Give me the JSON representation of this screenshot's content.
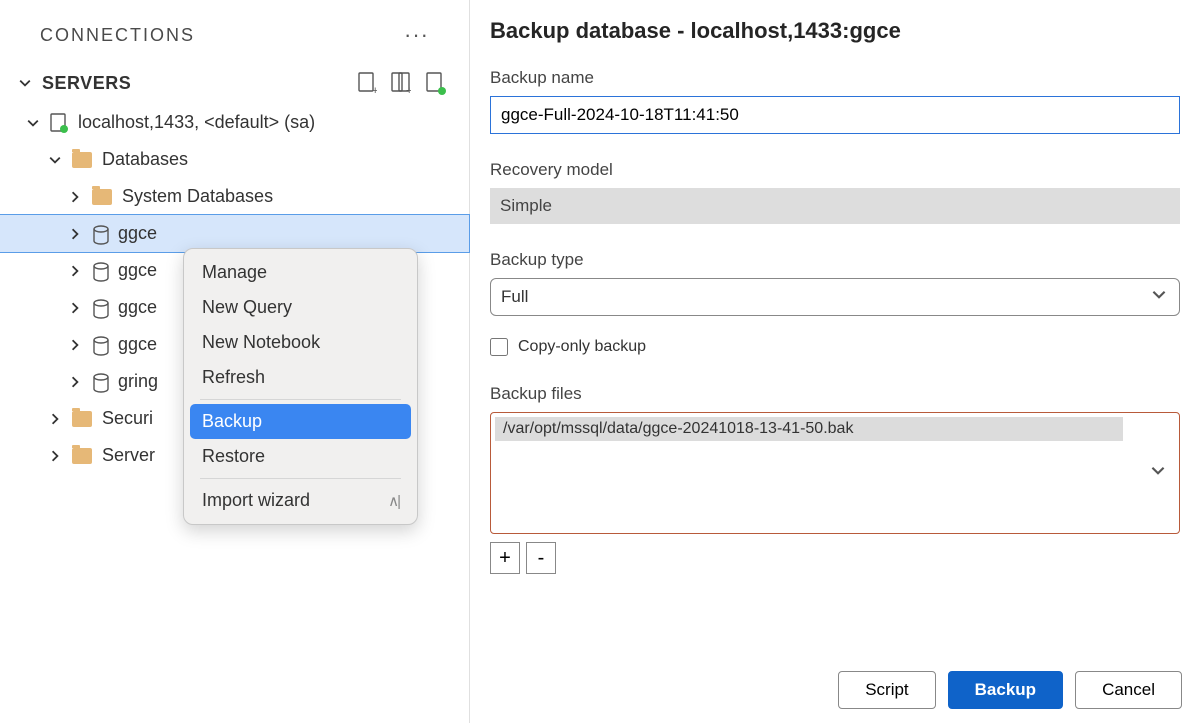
{
  "sidebar": {
    "connections_label": "CONNECTIONS",
    "servers_label": "SERVERS",
    "server_name": "localhost,1433, <default> (sa)",
    "databases_label": "Databases",
    "system_db_label": "System Databases",
    "db_items": [
      "ggce",
      "ggce",
      "ggce",
      "ggce",
      "gring"
    ],
    "security_label": "Securi",
    "server_objects_label": "Server"
  },
  "context_menu": {
    "items": {
      "manage": "Manage",
      "new_query": "New Query",
      "new_notebook": "New Notebook",
      "refresh": "Refresh",
      "backup": "Backup",
      "restore": "Restore",
      "import_wizard": "Import wizard"
    }
  },
  "panel": {
    "title": "Backup database - localhost,1433:ggce",
    "backup_name_label": "Backup name",
    "backup_name_value": "ggce-Full-2024-10-18T11:41:50",
    "recovery_label": "Recovery model",
    "recovery_value": "Simple",
    "backup_type_label": "Backup type",
    "backup_type_value": "Full",
    "copy_only_label": "Copy-only backup",
    "backup_files_label": "Backup files",
    "file_path": "/var/opt/mssql/data/ggce-20241018-13-41-50.bak",
    "add_label": "+",
    "remove_label": "-",
    "script_label": "Script",
    "backup_btn_label": "Backup",
    "cancel_label": "Cancel"
  }
}
